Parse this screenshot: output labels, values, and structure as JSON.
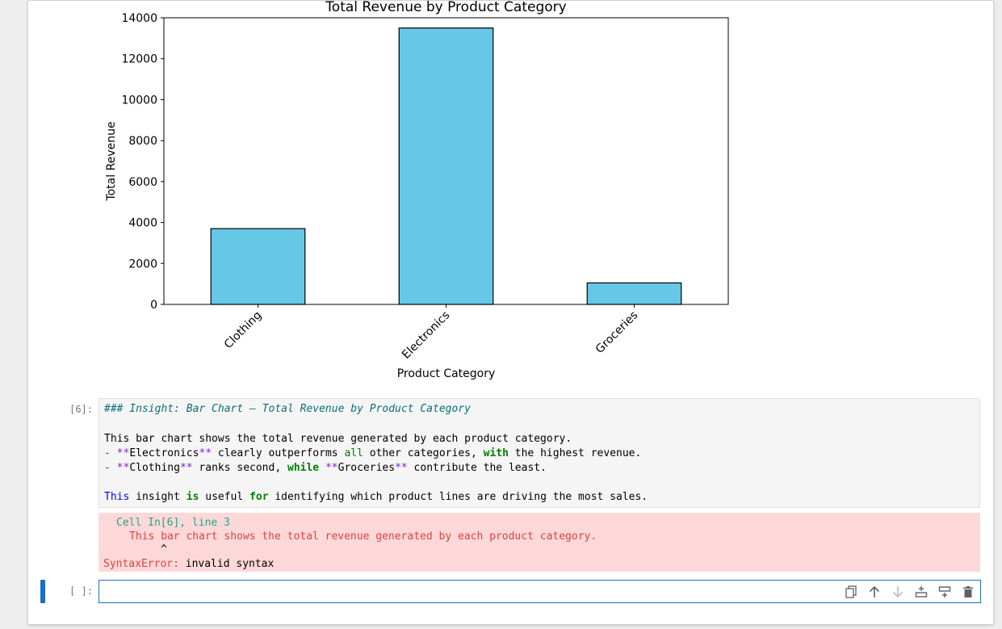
{
  "chart_data": {
    "type": "bar",
    "title": "Total Revenue by Product Category",
    "xlabel": "Product Category",
    "ylabel": "Total Revenue",
    "categories": [
      "Clothing",
      "Electronics",
      "Groceries"
    ],
    "values": [
      3700,
      13500,
      1050
    ],
    "ylim": [
      0,
      14000
    ],
    "yticks": [
      0,
      2000,
      4000,
      6000,
      8000,
      10000,
      12000,
      14000
    ],
    "bar_color": "#66c8e6",
    "edge_color": "#000000",
    "grid": false,
    "legend": "none"
  },
  "markdown_cell": {
    "prompt": "[6]:",
    "heading": "### Insight: Bar Chart – Total Revenue by Product Category",
    "line1": "This bar chart shows the total revenue generated by each product category.",
    "bullet1": {
      "dash": "- **",
      "strong": "Electronics",
      "close": "**",
      "text_a": " clearly outperforms ",
      "kw_all": "all",
      "text_b": " other categories, ",
      "kw_with": "with",
      "text_c": " the highest revenue."
    },
    "bullet2": {
      "dash": "- **",
      "strong1": "Clothing",
      "close1": "**",
      "text_a": " ranks second, ",
      "kw_while": "while",
      "open2": " **",
      "strong2": "Groceries",
      "close2": "**",
      "text_b": " contribute the least."
    },
    "closing": {
      "kw_this": "This",
      "text_a": " insight ",
      "kw_is": "is",
      "text_b": " useful ",
      "kw_for": "for",
      "text_c": " identifying which product lines are driving the most sales."
    }
  },
  "error_output": {
    "cell_ref": "Cell In[6], line 3",
    "code_line": "This bar chart shows the total revenue generated by each product category.",
    "caret": "^",
    "error_type": "SyntaxError:",
    "error_msg": " invalid syntax"
  },
  "empty_cell": {
    "prompt": "[ ]:"
  },
  "toolbar_icons": [
    "duplicate-icon",
    "move-up-icon",
    "move-down-icon",
    "insert-above-icon",
    "insert-below-icon",
    "delete-icon"
  ],
  "colors": {
    "accent": "#1a6ec4",
    "error_bg": "#fdd8d8"
  }
}
